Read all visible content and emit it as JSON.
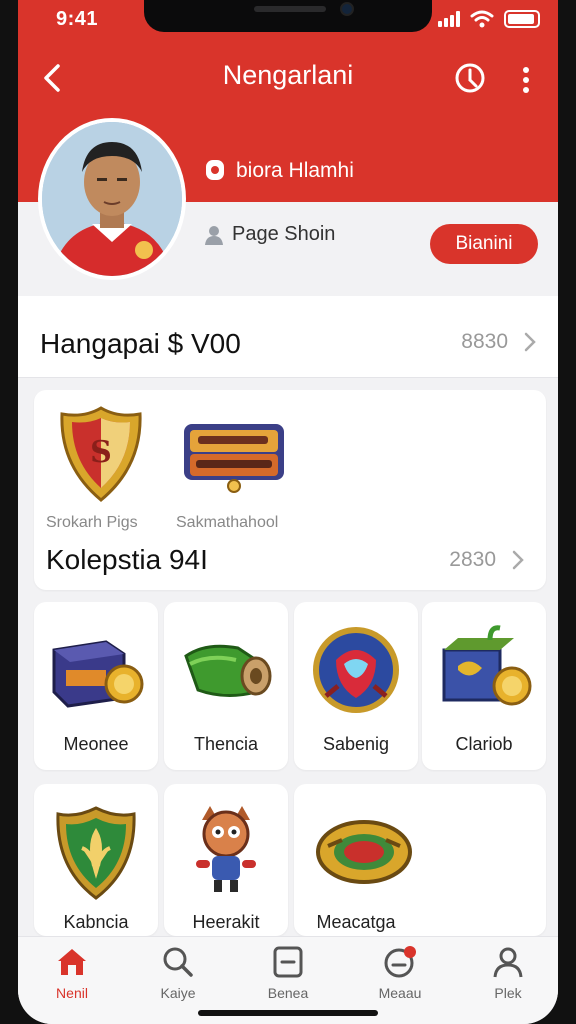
{
  "status_bar": {
    "time": "9:41"
  },
  "header": {
    "title": "Nengarlani",
    "owner_name": "biora Hlamhi",
    "subtitle": "Page Shoin",
    "action_label": "Bianini"
  },
  "summary": {
    "title": "Hangapai $ V00",
    "value": "8830"
  },
  "collection": {
    "items": [
      {
        "label": "Srokarh Pigs",
        "icon": "shield-badge-icon"
      },
      {
        "label": "Sakmathahool",
        "icon": "game-logo-icon"
      }
    ],
    "title": "Kolepstia 94I",
    "value": "2830"
  },
  "grid_items": [
    {
      "label": "Meonee",
      "icon": "treasure-chest-icon"
    },
    {
      "label": "Thencia",
      "icon": "green-scroll-icon"
    },
    {
      "label": "Sabenig",
      "icon": "mask-shield-icon"
    },
    {
      "label": "Clariob",
      "icon": "loot-box-icon"
    },
    {
      "label": "Kabncia",
      "icon": "leaf-shield-icon"
    },
    {
      "label": "Heerakit",
      "icon": "mascot-character-icon"
    },
    {
      "label": "Meacatga",
      "icon": "emblem-ring-icon"
    }
  ],
  "tabbar": {
    "tabs": [
      {
        "label": "Nenil",
        "icon": "home-icon",
        "active": true
      },
      {
        "label": "Kaiye",
        "icon": "search-icon",
        "active": false
      },
      {
        "label": "Benea",
        "icon": "inbox-icon",
        "active": false
      },
      {
        "label": "Meaau",
        "icon": "notification-icon",
        "active": false
      },
      {
        "label": "Plek",
        "icon": "profile-icon",
        "active": false
      }
    ]
  },
  "colors": {
    "accent": "#d9342b",
    "background": "#f2f2f4",
    "card": "#ffffff"
  }
}
